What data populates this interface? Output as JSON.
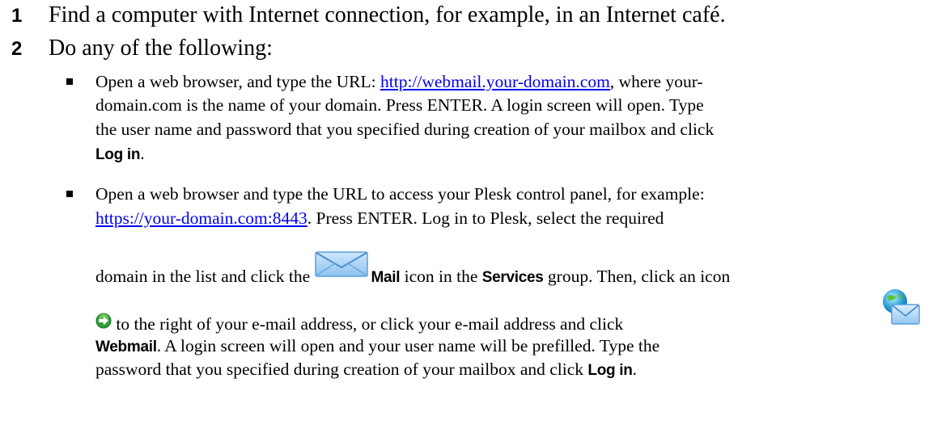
{
  "steps": [
    {
      "num": "1",
      "text": "Find a computer with Internet connection, for example, in an Internet café."
    },
    {
      "num": "2",
      "text": "Do any of the following:"
    }
  ],
  "bullet1": {
    "l1_pre": "Open a web browser, and type the URL: ",
    "l1_link": "http://webmail.your-domain.com",
    "l1_post": ", where your-",
    "l2": "domain.com is the name of your domain. Press ENTER. A login screen will open. Type",
    "l3": "the user name and password that you specified during creation of your mailbox and click",
    "l4_btn": "Log in",
    "l4_post": "."
  },
  "bullet2": {
    "l1": "Open a web browser and type the URL to access your Plesk control panel, for example:",
    "l2_link": "https://your-domain.com:8443",
    "l2_post": ". Press ENTER. Log in to Plesk, select the required",
    "l3_pre": "domain in the list and click the ",
    "l3_mail": "Mail",
    "l3_mid": " icon in the ",
    "l3_services": "Services",
    "l3_post": " group. Then, click an icon",
    "l4": " to the right of your e-mail address, or click your e-mail address and click",
    "l5_webmail": "Webmail",
    "l5_post": ". A login screen will open and your user name will be prefilled. Type the",
    "l6_pre": "password that you specified during creation of your mailbox and click ",
    "l6_btn": "Log in",
    "l6_post": "."
  },
  "icons": {
    "mail": "mail-envelope-icon",
    "go": "green-arrow-icon",
    "webmail": "globe-envelope-icon"
  }
}
